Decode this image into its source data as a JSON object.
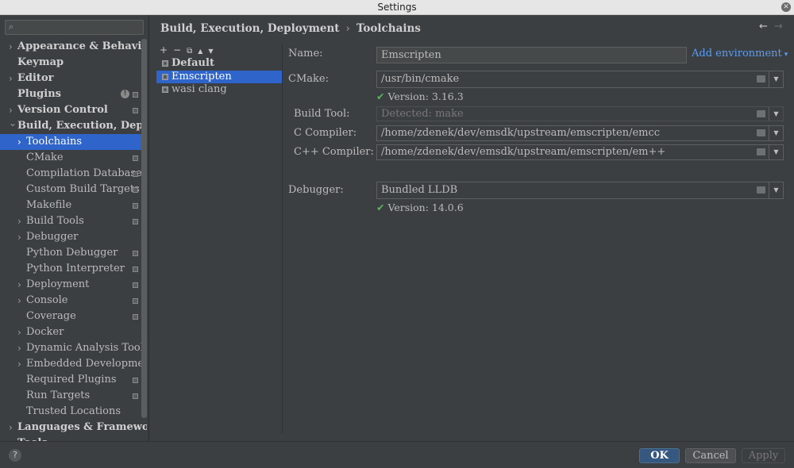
{
  "window": {
    "title": "Settings"
  },
  "search": {
    "placeholder": ""
  },
  "sidebar": {
    "items": [
      {
        "label": "Appearance & Behavior",
        "level": 0,
        "bold": true,
        "chevron": "right"
      },
      {
        "label": "Keymap",
        "level": 0,
        "bold": true,
        "chevron": ""
      },
      {
        "label": "Editor",
        "level": 0,
        "bold": true,
        "chevron": "right"
      },
      {
        "label": "Plugins",
        "level": 0,
        "bold": true,
        "chevron": "",
        "info": true,
        "project": true
      },
      {
        "label": "Version Control",
        "level": 0,
        "bold": true,
        "chevron": "right",
        "project": true
      },
      {
        "label": "Build, Execution, Deployment",
        "level": 0,
        "bold": true,
        "chevron": "down"
      },
      {
        "label": "Toolchains",
        "level": 1,
        "chevron": "right",
        "selected": true
      },
      {
        "label": "CMake",
        "level": 1,
        "chevron": "",
        "project": true
      },
      {
        "label": "Compilation Database",
        "level": 1,
        "chevron": "",
        "project": true
      },
      {
        "label": "Custom Build Targets",
        "level": 1,
        "chevron": "",
        "project": true
      },
      {
        "label": "Makefile",
        "level": 1,
        "chevron": "",
        "project": true
      },
      {
        "label": "Build Tools",
        "level": 1,
        "chevron": "right",
        "project": true
      },
      {
        "label": "Debugger",
        "level": 1,
        "chevron": "right"
      },
      {
        "label": "Python Debugger",
        "level": 1,
        "chevron": "",
        "project": true
      },
      {
        "label": "Python Interpreter",
        "level": 1,
        "chevron": "",
        "project": true
      },
      {
        "label": "Deployment",
        "level": 1,
        "chevron": "right",
        "project": true
      },
      {
        "label": "Console",
        "level": 1,
        "chevron": "right",
        "project": true
      },
      {
        "label": "Coverage",
        "level": 1,
        "chevron": "",
        "project": true
      },
      {
        "label": "Docker",
        "level": 1,
        "chevron": "right"
      },
      {
        "label": "Dynamic Analysis Tools",
        "level": 1,
        "chevron": "right"
      },
      {
        "label": "Embedded Development",
        "level": 1,
        "chevron": "right"
      },
      {
        "label": "Required Plugins",
        "level": 1,
        "chevron": "",
        "project": true
      },
      {
        "label": "Run Targets",
        "level": 1,
        "chevron": "",
        "project": true
      },
      {
        "label": "Trusted Locations",
        "level": 1,
        "chevron": ""
      },
      {
        "label": "Languages & Frameworks",
        "level": 0,
        "bold": true,
        "chevron": "right"
      },
      {
        "label": "Tools",
        "level": 0,
        "bold": true,
        "chevron": "right"
      }
    ]
  },
  "header": {
    "crumb_parent": "Build, Execution, Deployment",
    "crumb_sep": "›",
    "crumb_current": "Toolchains",
    "back": "←",
    "forward": "→"
  },
  "toolchains": {
    "toolbar": {
      "add": "+",
      "remove": "−",
      "copy": "⧉",
      "up": "▲",
      "down": "▼"
    },
    "items": [
      {
        "label": "Default",
        "bold": true
      },
      {
        "label": "Emscripten",
        "selected": true
      },
      {
        "label": "wasi clang"
      }
    ]
  },
  "form": {
    "name_label": "Name:",
    "name_value": "Emscripten",
    "add_env": "Add environment",
    "add_env_caret": "▾",
    "cmake_label": "CMake:",
    "cmake_value": "/usr/bin/cmake",
    "cmake_version": "Version: 3.16.3",
    "build_tool_label": "Build Tool:",
    "build_tool_value": "Detected: make",
    "c_label": "C Compiler:",
    "c_value": "/home/zdenek/dev/emsdk/upstream/emscripten/emcc",
    "cpp_label": "C++ Compiler:",
    "cpp_value": "/home/zdenek/dev/emsdk/upstream/emscripten/em++",
    "debugger_label": "Debugger:",
    "debugger_value": "Bundled LLDB",
    "debugger_version": "Version: 14.0.6",
    "check": "✔",
    "drop": "▼"
  },
  "footer": {
    "help": "?",
    "ok": "OK",
    "cancel": "Cancel",
    "apply": "Apply"
  },
  "colors": {
    "bg": "#3c3f41",
    "selection": "#2f65ca",
    "link": "#589df6",
    "ok_button": "#365880",
    "check": "#5fb25f"
  }
}
